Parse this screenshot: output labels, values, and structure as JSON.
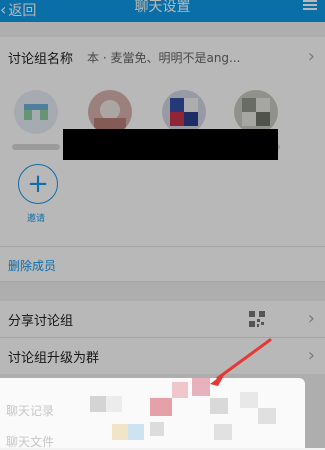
{
  "header": {
    "back_label": "返回",
    "title": "聊天设置",
    "accent_color": "#0f9ae8",
    "menu_icon": "menu-icon"
  },
  "group_name": {
    "label": "讨论组名称",
    "value": "本 · 麦當免、明明不是ang..."
  },
  "members": {
    "add_label": "邀请",
    "remove_label": "删除成员"
  },
  "share": {
    "label": "分享讨论组",
    "qr_icon": "qr-code-icon"
  },
  "upgrade": {
    "label": "讨论组升级为群"
  },
  "bottom_sheet": {
    "items": [
      "聊天记录",
      "聊天文件"
    ]
  },
  "annotation": {
    "arrow_color": "#e53935"
  }
}
